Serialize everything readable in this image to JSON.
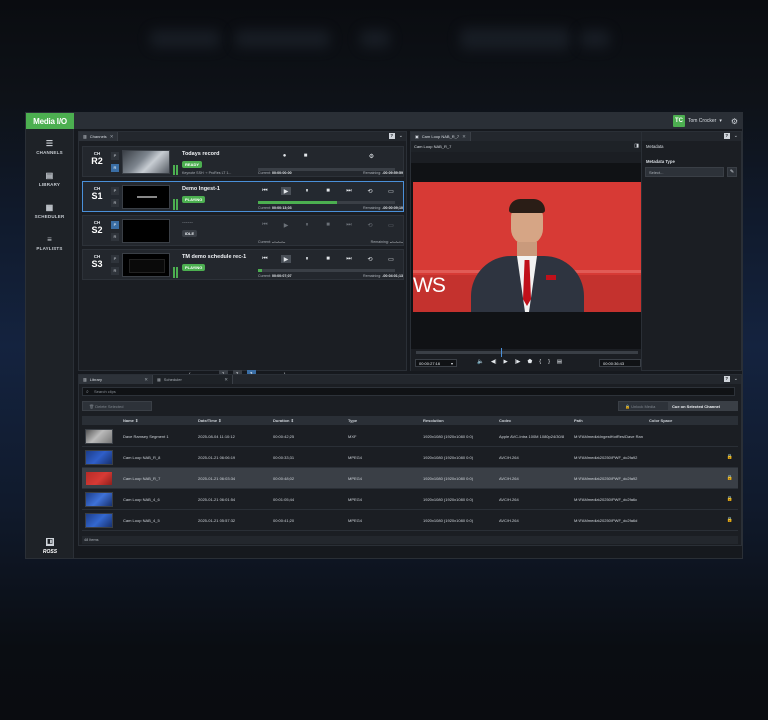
{
  "app": {
    "title": "Media I/O",
    "user_initials": "TC",
    "user_name": "Tom Crocker",
    "accent": "#4caf50"
  },
  "sidebar": {
    "items": [
      {
        "label": "CHANNELS",
        "icon": "channels-icon"
      },
      {
        "label": "LIBRARY",
        "icon": "library-icon"
      },
      {
        "label": "SCHEDULER",
        "icon": "scheduler-icon"
      },
      {
        "label": "PLAYLISTS",
        "icon": "playlists-icon"
      }
    ],
    "brand": "ROSS"
  },
  "channels_panel": {
    "tab": "Channels",
    "channels": [
      {
        "prefix": "CH",
        "id": "R2",
        "name": "Todays record",
        "status": "READY",
        "source": "Keynote SSH",
        "dest": "ProRes LT 1...",
        "current_label": "Current:",
        "current": "00:00:00:00",
        "remaining_label": "Remaining:",
        "remaining": "-00:09:59:59",
        "progress": 0
      },
      {
        "prefix": "CH",
        "id": "S1",
        "name": "Demo Ingest-1",
        "status": "PLAYING",
        "current_label": "Current:",
        "current": "00:00:13;03",
        "remaining_label": "Remaining:",
        "remaining": "-00:00:09;10",
        "progress": 58
      },
      {
        "prefix": "CH",
        "id": "S2",
        "name": "------",
        "status": "IDLE",
        "current_label": "Current:",
        "current": "--:--:--:--",
        "remaining_label": "Remaining:",
        "remaining": "--:--:--:--",
        "progress": 0
      },
      {
        "prefix": "CH",
        "id": "S3",
        "name": "TM demo schedule rec-1",
        "status": "PLAYING",
        "current_label": "Current:",
        "current": "00:00:07;07",
        "remaining_label": "Remaining:",
        "remaining": "-00:04:01;13",
        "progress": 3
      }
    ],
    "pages": [
      "1",
      "2",
      "3"
    ],
    "current_page": "3"
  },
  "viewer_panel": {
    "tab": "Cam Loop NAB_R_7",
    "clip_title": "Cam Loop NAB_R_7",
    "overlay_text": "WS",
    "timecode_in": "00:00:27:16",
    "timecode_out": "00:00:36:43"
  },
  "metadata_panel": {
    "title": "Metadata",
    "type_label": "Metadata Type",
    "select_placeholder": "Select..."
  },
  "library_panel": {
    "tabs": [
      "Library",
      "Scheduler"
    ],
    "search_placeholder": "Search clips",
    "delete_label": "Delete Selected",
    "unlock_label": "Unlock Media",
    "cue_label": "Cue on Selected Channel",
    "columns": [
      "Name",
      "Date/Time",
      "Duration",
      "Type",
      "Resolution",
      "Codec",
      "Path",
      "Color Space"
    ],
    "rows": [
      {
        "name": "Dave Ramsey Segment 1",
        "date": "2025-08-04 11:10:12",
        "duration": "00:00:42;25",
        "type": "MXF",
        "resolution": "1920x1080 (1920x1080 0:0)",
        "codec": "Apple AVC-Intra 100M 1080p24/30/8",
        "path": "M:\\FAMmedia\\IngestHotRes\\Dave Ran",
        "locked": false
      },
      {
        "name": "Cam Loop NAB_R_8",
        "date": "2025-01-21 06:06:19",
        "duration": "00:00:33;31",
        "type": "MPEG4",
        "resolution": "1920x1080 (1920x1080 0:0)",
        "codec": "AVC/H.264",
        "path": "M:\\FAMmedia\\20250\\PWF_dc2fa92",
        "locked": true
      },
      {
        "name": "Cam Loop NAB_R_7",
        "date": "2025-01-21 06:03:34",
        "duration": "00:00:48;02",
        "type": "MPEG4",
        "resolution": "1920x1080 (1920x1080 0:0)",
        "codec": "AVC/H.264",
        "path": "M:\\FAMmedia\\20250\\PWF_dc2fa92",
        "locked": true
      },
      {
        "name": "Cam Loop NAB_4_6",
        "date": "2025-01-21 06:01:54",
        "duration": "00:01:05;44",
        "type": "MPEG4",
        "resolution": "1920x1080 (1920x1080 0:0)",
        "codec": "AVC/H.264",
        "path": "M:\\FAMmedia\\20250\\PWF_dc2fa6c",
        "locked": true
      },
      {
        "name": "Cam Loop NAB_4_5",
        "date": "2025-01-21 05:57:32",
        "duration": "00:00:41;20",
        "type": "MPEG4",
        "resolution": "1920x1080 (1920x1080 0:0)",
        "codec": "AVC/H.264",
        "path": "M:\\FAMmedia\\20250\\PWF_dc2fa6d",
        "locked": true
      }
    ],
    "footer": "48 Items"
  }
}
